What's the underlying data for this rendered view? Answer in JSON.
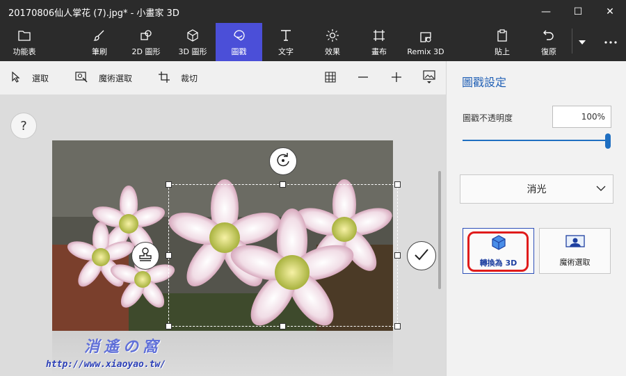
{
  "window": {
    "title": "20170806仙人掌花 (7).jpg* - 小畫家 3D",
    "controls": [
      "—",
      "☐",
      "✕"
    ]
  },
  "ribbon": {
    "menu": "功能表",
    "tools": [
      {
        "label": "筆刷",
        "icon": "brush-icon"
      },
      {
        "label": "2D 圖形",
        "icon": "2d-shapes-icon"
      },
      {
        "label": "3D 圖形",
        "icon": "3d-shapes-icon"
      },
      {
        "label": "圖戳",
        "icon": "sticker-icon"
      },
      {
        "label": "文字",
        "icon": "text-icon"
      },
      {
        "label": "效果",
        "icon": "effects-icon"
      },
      {
        "label": "畫布",
        "icon": "canvas-icon"
      },
      {
        "label": "Remix 3D",
        "icon": "remix-icon"
      }
    ],
    "paste": "貼上",
    "undo": "復原",
    "active_tool": "圖戳",
    "accent_color": "#4b4fd8"
  },
  "subtoolbar": {
    "select": "選取",
    "magic_select": "魔術選取",
    "crop": "裁切"
  },
  "canvas": {
    "help": "?",
    "watermark_line1": "消遙の窩",
    "watermark_line2": "http://www.xiaoyao.tw/"
  },
  "panel": {
    "title": "圖戳設定",
    "opacity_label": "圖戳不透明度",
    "opacity_value": "100%",
    "opacity_level": 1.0,
    "finish_dropdown": "消光",
    "make_3d_button": "轉換為 3D",
    "magic_select_button": "魔術選取",
    "accent_color": "#1f6fc1",
    "highlight_color": "#e01b1b"
  }
}
